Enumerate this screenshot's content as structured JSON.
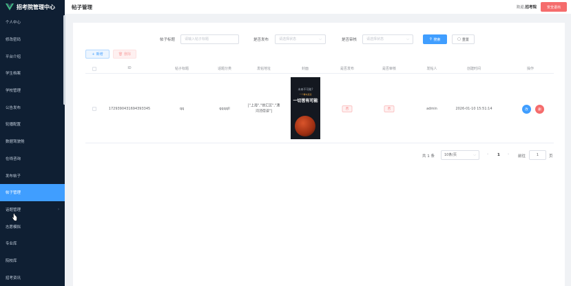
{
  "app": {
    "title": "招考院管理中心"
  },
  "sidebar": {
    "items": [
      {
        "label": "个人中心"
      },
      {
        "label": "修改密码"
      },
      {
        "label": "平台介绍"
      },
      {
        "label": "学生档案"
      },
      {
        "label": "学校管理"
      },
      {
        "label": "公告发布"
      },
      {
        "label": "轮播配置"
      },
      {
        "label": "数据驾驶舱"
      },
      {
        "label": "在线咨询"
      },
      {
        "label": "发布帖子"
      },
      {
        "label": "帖子管理"
      },
      {
        "label": "话题管理"
      },
      {
        "label": "志愿模拟"
      },
      {
        "label": "专业库"
      },
      {
        "label": "院校库"
      },
      {
        "label": "招考资讯"
      }
    ],
    "active_index": 10,
    "arrow_index": 11
  },
  "header": {
    "page_title": "帖子管理",
    "welcome_prefix": "欢迎,",
    "username": "招考院",
    "logout_label": "安全退出"
  },
  "search": {
    "title_label": "帖子标题",
    "title_placeholder": "请输入帖子标题",
    "publish_label": "是否发布",
    "publish_placeholder": "请选择状态",
    "audit_label": "是否审核",
    "audit_placeholder": "请选择状态",
    "search_button": "搜索",
    "reset_button": "重置"
  },
  "toolbar": {
    "add_label": "新增",
    "delete_label": "删除"
  },
  "table": {
    "headers": [
      "ID",
      "帖子标题",
      "话题分类",
      "发帖地址",
      "封面",
      "是否发布",
      "是否审核",
      "发帖人",
      "创建时间",
      "操作"
    ],
    "rows": [
      {
        "id": "1729390431694393345",
        "title": "qq",
        "topic": "qqqqll",
        "address": "[\"上海\",\"徐汇区\",\"漕河泾街道\"]",
        "cover": {
          "line1": "未来不可能?",
          "line2": "一个看似遥远",
          "line3": "一切皆有可能"
        },
        "published": "否",
        "audited": "否",
        "author": "admin",
        "created": "2026-01-10 15:51:14",
        "edit_icon_label": "改",
        "delete_icon_label": "删"
      }
    ]
  },
  "pagination": {
    "total": "共 1 条",
    "page_size": "10条/页",
    "prev": "‹",
    "current": "1",
    "next": "›",
    "goto_label": "前往",
    "goto_value": "1",
    "page_suffix": "页"
  },
  "colors": {
    "sidebar_bg": "#0f1f33",
    "accent": "#409eff",
    "danger": "#f56c6c"
  }
}
